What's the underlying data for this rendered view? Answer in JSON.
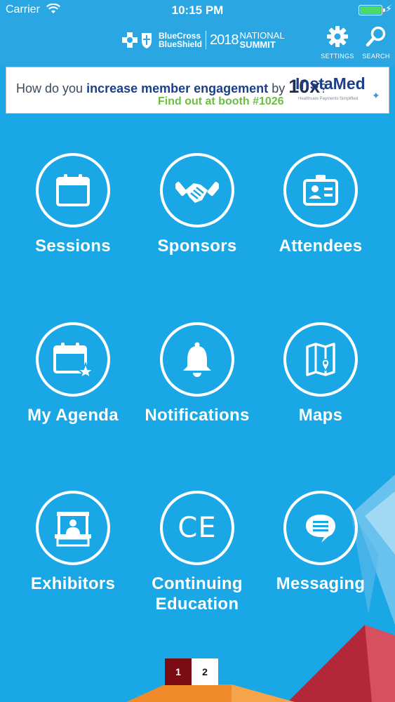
{
  "status_bar": {
    "carrier": "Carrier",
    "time": "10:15 PM"
  },
  "header": {
    "brand_line1": "BlueCross",
    "brand_line2": "BlueShield",
    "year": "2018",
    "event_line1": "NATIONAL",
    "event_line2": "SUMMIT",
    "settings_label": "SETTINGS",
    "search_label": "SEARCH"
  },
  "banner": {
    "text_pre": "How do you ",
    "text_bold": "increase member engagement",
    "text_mid": " by ",
    "text_big": "10x",
    "text_post": "?",
    "cta": "Find out at booth #1026",
    "sponsor": "InstaMed",
    "sponsor_tagline": "Healthcare Payments Simplified"
  },
  "menu": [
    {
      "label": "Sessions",
      "icon": "calendar-icon"
    },
    {
      "label": "Sponsors",
      "icon": "handshake-icon"
    },
    {
      "label": "Attendees",
      "icon": "id-badge-icon"
    },
    {
      "label": "My Agenda",
      "icon": "calendar-star-icon"
    },
    {
      "label": "Notifications",
      "icon": "bell-icon"
    },
    {
      "label": "Maps",
      "icon": "map-icon"
    },
    {
      "label": "Exhibitors",
      "icon": "booth-icon"
    },
    {
      "label": "Continuing\nEducation",
      "icon": "ce-icon",
      "icon_text": "CE"
    },
    {
      "label": "Messaging",
      "icon": "chat-bubble-icon"
    }
  ],
  "pager": {
    "page1": "1",
    "page2": "2",
    "current": "1"
  },
  "colors": {
    "background": "#1aa7e6",
    "header": "#2aa6e2",
    "pager_active": "#7a0b12",
    "banner_green": "#6cbe3f"
  }
}
